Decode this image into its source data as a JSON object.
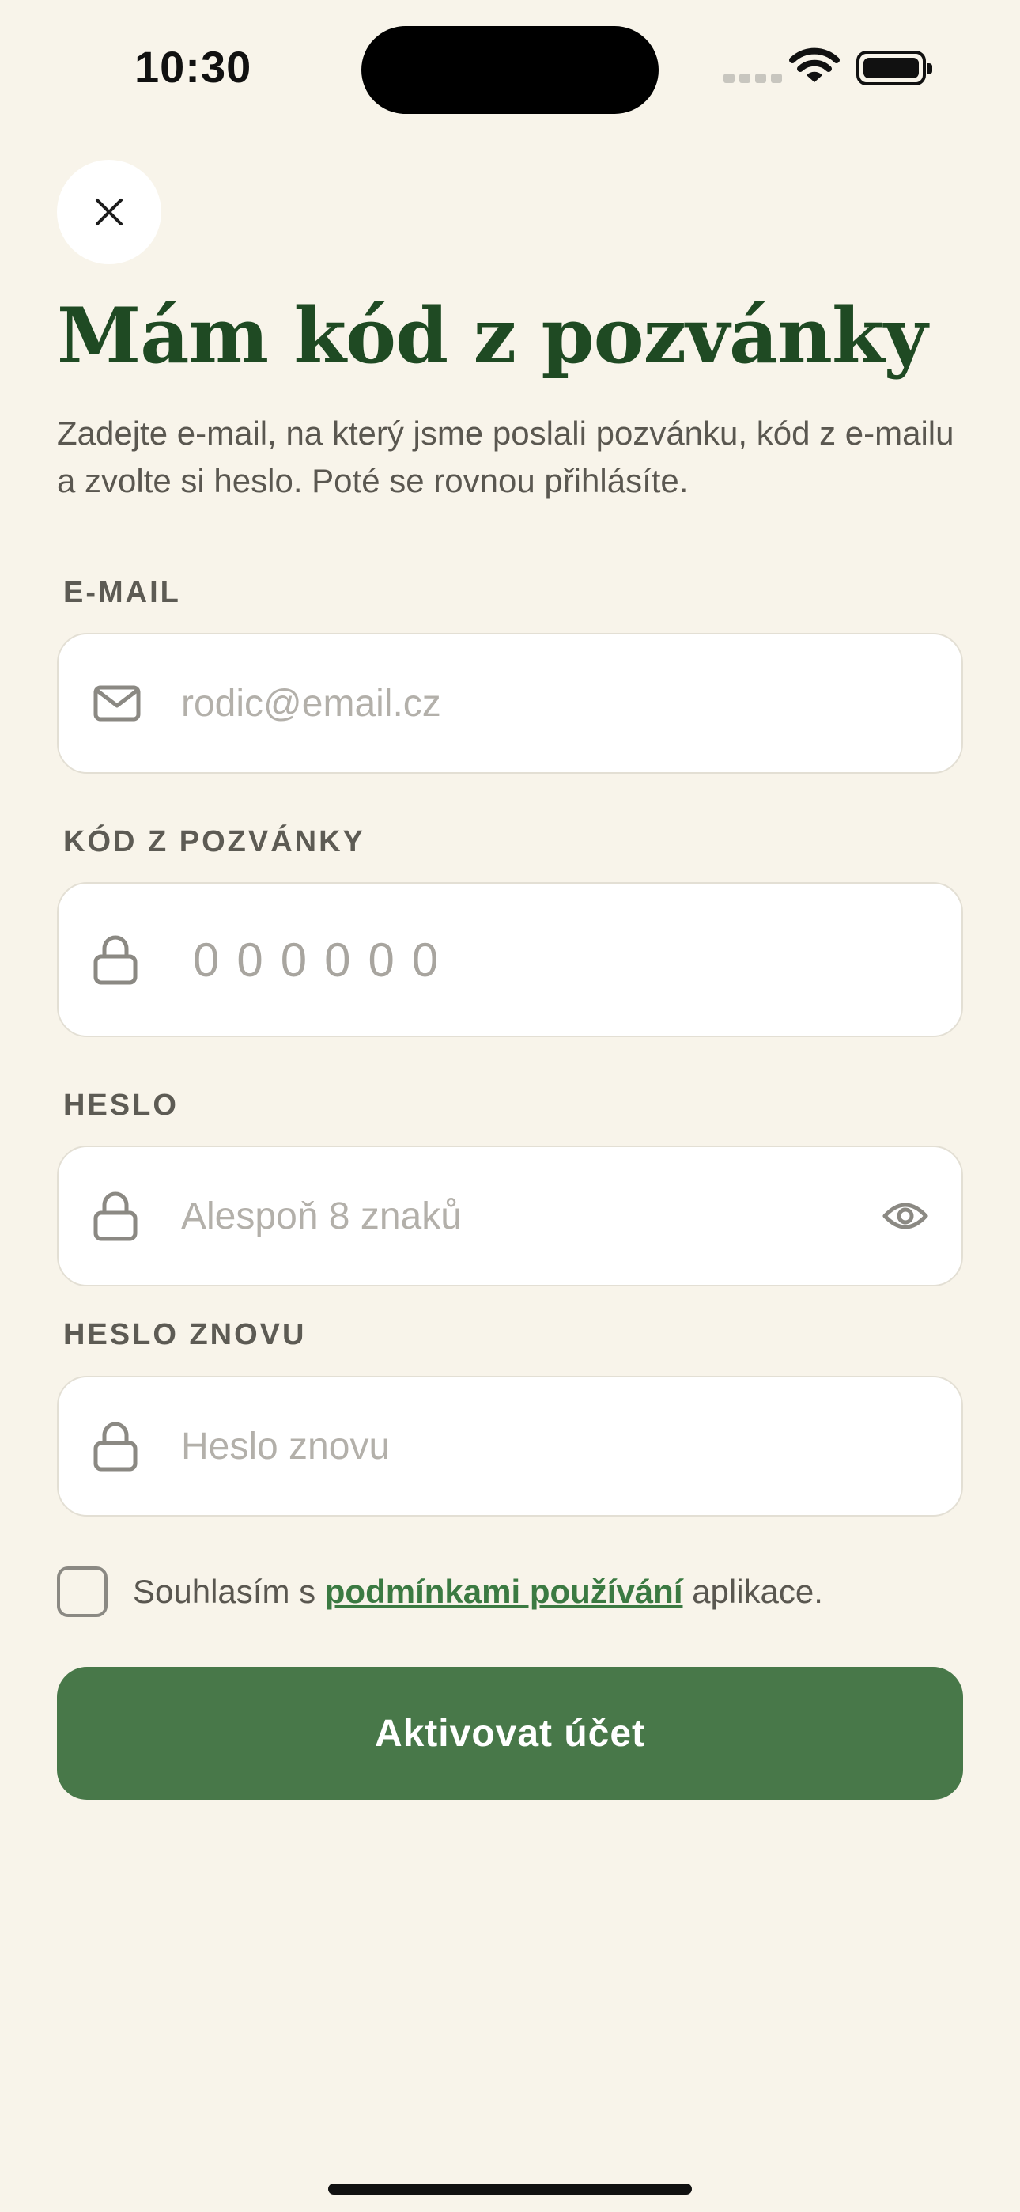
{
  "status_bar": {
    "time": "10:30",
    "icons": [
      "cellular-signal-icon",
      "wifi-icon",
      "battery-icon"
    ]
  },
  "header": {
    "close_icon": "close-icon",
    "title": "Mám kód z pozvánky",
    "subtitle": "Zadejte e-mail, na který jsme poslali pozvánku, kód z e-mailu a zvolte si heslo. Poté se rovnou přihlásíte."
  },
  "form": {
    "email": {
      "label": "E-MAIL",
      "placeholder": "rodic@email.cz",
      "value": "",
      "icon": "envelope-icon"
    },
    "code": {
      "label": "KÓD Z POZVÁNKY",
      "placeholder": "000000",
      "value": "",
      "icon": "lock-icon"
    },
    "password": {
      "label": "HESLO",
      "placeholder": "Alespoň 8 znaků",
      "value": "",
      "icon": "lock-icon",
      "toggle_icon": "eye-icon"
    },
    "password_repeat": {
      "label": "HESLO ZNOVU",
      "placeholder": "Heslo znovu",
      "value": "",
      "icon": "lock-icon"
    },
    "terms": {
      "checked": false,
      "prefix": "Souhlasím s ",
      "link": "podmínkami používání",
      "suffix": " aplikace."
    },
    "submit_label": "Aktivovat účet"
  },
  "colors": {
    "background": "#f8f4ea",
    "title": "#1f4a23",
    "primary": "#487849",
    "link": "#3b7a42"
  }
}
